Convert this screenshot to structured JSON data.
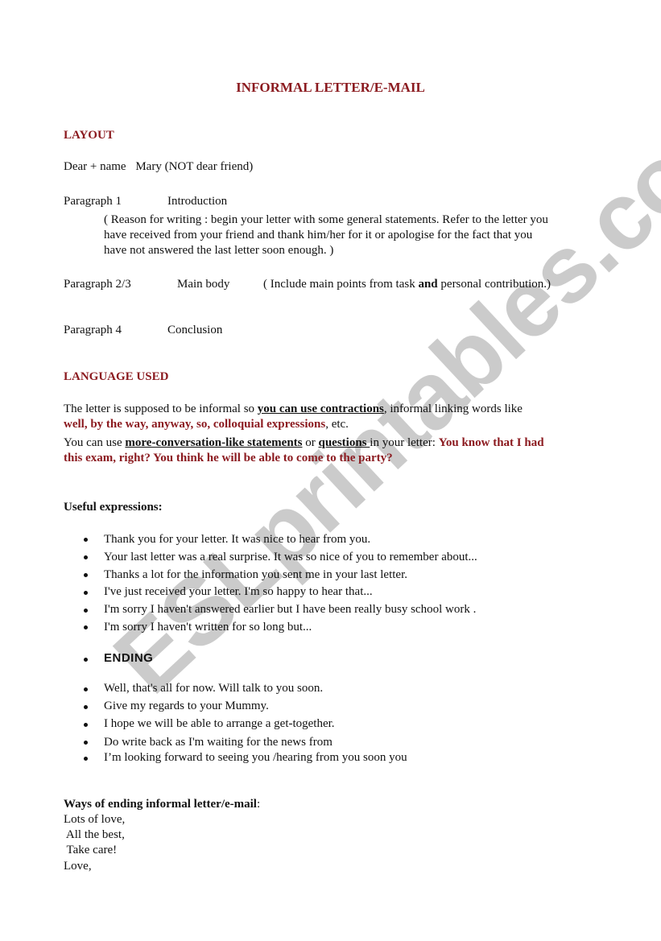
{
  "document": {
    "title": "INFORMAL LETTER/E-MAIL",
    "watermark": "ESLprintables.com",
    "colors": {
      "accent_red": "#8b1a1f",
      "text": "#111111",
      "watermark": "#a0a0a0"
    },
    "layout_section": {
      "heading": "LAYOUT",
      "dear_line": {
        "label": "Dear  + name",
        "value": "Mary (NOT dear friend)"
      },
      "paragraph1": {
        "label": "Paragraph 1",
        "name": "Introduction",
        "description_lines": [
          "( Reason for writing :  begin your letter with some general statements. Refer to the letter you",
          "have received from your friend and thank him/her for it or apologise for the fact that you",
          "have not answered the last letter soon enough. )"
        ]
      },
      "paragraph23": {
        "label": "Paragraph 2/3",
        "name": "Main body",
        "note_before": "( Include main points from task ",
        "note_bold": "and",
        "note_after": " personal contribution.)"
      },
      "paragraph4": {
        "label": "Paragraph 4",
        "name": "Conclusion"
      }
    },
    "language_section": {
      "heading": "LANGUAGE USED",
      "line1": {
        "pre": "The letter is supposed to be informal so ",
        "underlined": "you can use contractions",
        "post": ", informal linking words like"
      },
      "line2": {
        "red_bold": "well, by the way, anyway, so, colloquial expressions",
        "post": ", etc."
      },
      "line3": {
        "pre": "You can use ",
        "underlined1": "more-conversation-like statements",
        "mid": " or ",
        "underlined2": "questions ",
        "post": "in your letter: ",
        "red_bold": "You know that I had"
      },
      "line4": {
        "red_bold": "this exam, right? You think he will be able to come to the party?"
      }
    },
    "useful_expressions": {
      "heading": "Useful expressions:",
      "items": [
        "Thank you for your letter. It was nice to hear from you.",
        "Your last letter was a real surprise. It was so nice of you to remember about...",
        "Thanks a lot for the information you sent me in your last letter.",
        "I've just received your letter. I'm so happy to hear that...",
        "I'm sorry I haven't answered earlier but I  have been  really busy  school work .",
        "I'm sorry I haven't written for so long but..."
      ],
      "ending_heading": "ENDING",
      "ending_items": [
        "Well, that's all for now. Will talk to you soon.",
        "Give my regards to your Mummy.",
        "I hope we will be able to arrange a get-together.",
        "Do write back as I'm waiting for the news from",
        "I’m looking forward to seeing you /hearing from you soon you"
      ]
    },
    "ways_of_ending": {
      "heading": "Ways of ending informal letter/e-mail",
      "heading_suffix": ":",
      "lines": [
        "Lots of love,",
        " All the best,",
        " Take care!",
        "Love,"
      ]
    }
  }
}
